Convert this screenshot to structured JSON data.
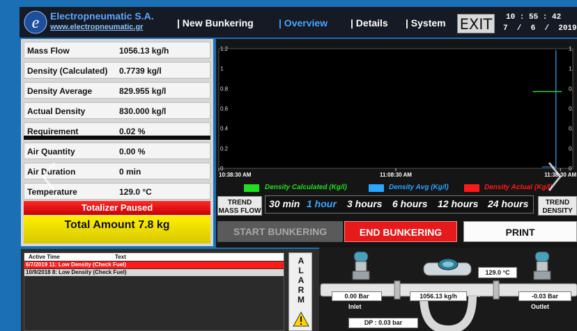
{
  "header": {
    "brand": "Electropneumatic S.A.",
    "url": "www.electropneumatic.gr",
    "nav": [
      "| New Bunkering",
      "| Overview",
      "| Details",
      "| System"
    ],
    "active_nav": "| Overview",
    "exit_label": "EXIT",
    "time": "10 : 55 : 42",
    "date": "7  /  6  /  2019"
  },
  "parameters": [
    {
      "label": "Mass Flow",
      "value": "1056.13 kg/h"
    },
    {
      "label": "Density (Calculated)",
      "value": "0.7739 kg/l"
    },
    {
      "label": "Density Average",
      "value": "829.955 kg/l"
    },
    {
      "label": "Actual Density",
      "value": "830.000 kg/l"
    },
    {
      "label": "Requirement",
      "value": "0.02 %"
    },
    {
      "label": "Air Quantity",
      "value": "0.00 %"
    },
    {
      "label": "Air Duration",
      "value": "0 min"
    },
    {
      "label": "Temperature",
      "value": "129.0 °C"
    }
  ],
  "status": "Totalizer Paused",
  "total": "Total Amount  7.8 kg",
  "chart_data": {
    "type": "line",
    "x_ticks": [
      "10:38:30 AM",
      "11:08:30 AM",
      "11:38:30 AM"
    ],
    "yleft_ticks": [
      "1.2",
      "1",
      "0.8",
      "0.6",
      "0.4",
      "0.2",
      "0"
    ],
    "yright_ticks": [
      "1.",
      "1.",
      "0.",
      "0.",
      "0.",
      "0.",
      "0"
    ],
    "ylim": [
      0,
      1.2
    ],
    "series": [
      {
        "name": "Density Calculated (Kg/l)",
        "color": "#22dd22",
        "x_frac": [
          0.965,
          1.0
        ],
        "values": [
          0.77,
          0.77
        ]
      },
      {
        "name": "Density Avg (Kg/l)",
        "color": "#2aa6ff",
        "vertical_x_frac": 0.972
      },
      {
        "name": "Density Actual (Kg/l)",
        "color": "#ff1a1a"
      }
    ]
  },
  "trend_ranges": [
    "30 min",
    "1 hour",
    "3 hours",
    "6 hours",
    "12 hours",
    "24 hours"
  ],
  "trend_selected": "1 hour",
  "trend_mass_flow": "TREND MASS FLOW",
  "trend_density": "TREND DENSITY",
  "actions": {
    "start": "START BUNKERING",
    "end": "END BUNKERING",
    "print": "PRINT"
  },
  "alarms": {
    "head_time": "Active Time",
    "head_text": "Text",
    "rows": [
      {
        "text": "6/7/2019 11:  Low Density (Check Fuel)",
        "active": true
      },
      {
        "text": "10/9/2018 8:  Low Density (Check Fuel)",
        "active": false
      }
    ],
    "button_letters": [
      "A",
      "L",
      "A",
      "R",
      "M"
    ]
  },
  "process": {
    "temperature": "129.0 °C",
    "inlet_pressure": "0.00 Bar",
    "inlet_label": "Inlet",
    "flow": "1056.13 kg/h",
    "flow_arrow": "→",
    "outlet_pressure": "-0.03 Bar",
    "outlet_label": "Outlet",
    "dp": "DP : 0.03 bar"
  },
  "colors": {
    "accent": "#49a4ff",
    "alarm_red": "#ff1a1a",
    "total_yellow": "#ffe600",
    "end_red": "#e61a1a"
  }
}
